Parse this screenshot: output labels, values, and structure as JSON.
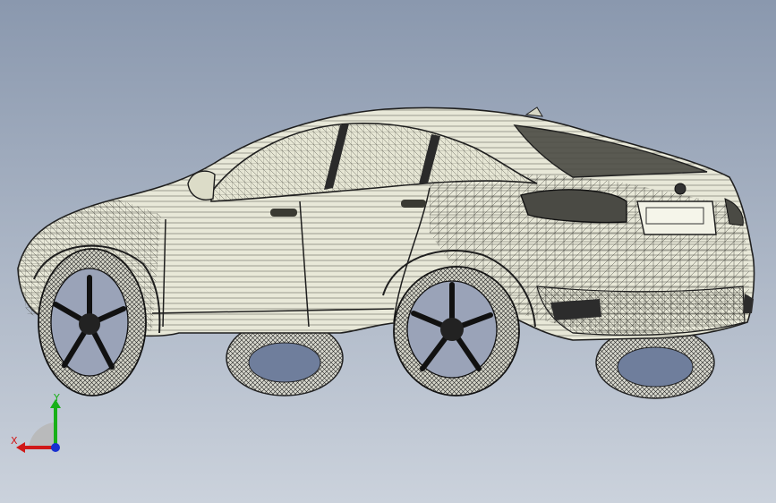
{
  "viewport": {
    "background_top": "#8a98ae",
    "background_bottom": "#cbd2dc",
    "model": "car-wireframe-mesh"
  },
  "triad": {
    "x_label": "X",
    "y_label": "Y",
    "x_color": "#d01818",
    "y_color": "#18b018",
    "z_color": "#1830d0"
  }
}
